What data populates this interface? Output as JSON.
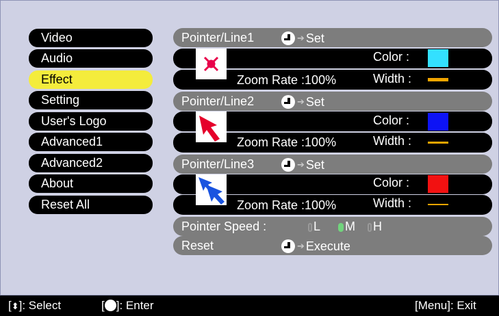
{
  "menu": {
    "items": [
      {
        "label": "Video"
      },
      {
        "label": "Audio"
      },
      {
        "label": "Effect",
        "active": true
      },
      {
        "label": "Setting"
      },
      {
        "label": "User's Logo"
      },
      {
        "label": "Advanced1"
      },
      {
        "label": "Advanced2"
      },
      {
        "label": "About"
      },
      {
        "label": "Reset All"
      }
    ]
  },
  "pointers": [
    {
      "title": "Pointer/Line1",
      "action": "Set",
      "color_label": "Color :",
      "color": "#33e0ff",
      "zoom_label": "Zoom Rate :",
      "zoom_value": "100%",
      "width_label": "Width :",
      "icon": "cross-icon"
    },
    {
      "title": "Pointer/Line2",
      "action": "Set",
      "color_label": "Color :",
      "color": "#0d13f5",
      "zoom_label": "Zoom Rate :",
      "zoom_value": "100%",
      "width_label": "Width :",
      "icon": "arrow-pointer-icon"
    },
    {
      "title": "Pointer/Line3",
      "action": "Set",
      "color_label": "Color :",
      "color": "#f21111",
      "zoom_label": "Zoom Rate :",
      "zoom_value": "100%",
      "width_label": "Width :",
      "icon": "double-arrow-icon"
    }
  ],
  "pointer_speed": {
    "label": "Pointer Speed :",
    "options": [
      "L",
      "M",
      "H"
    ],
    "selected": "M"
  },
  "reset": {
    "label": "Reset",
    "action": "Execute"
  },
  "status_bar": {
    "select": "]: Select",
    "enter": "]: Enter",
    "exit": "[Menu]: Exit"
  },
  "colors": {
    "panel": "#cfd1e4",
    "active_menu": "#f4ec3c",
    "header": "#7d7d7d",
    "width_line": "#f2a500"
  }
}
